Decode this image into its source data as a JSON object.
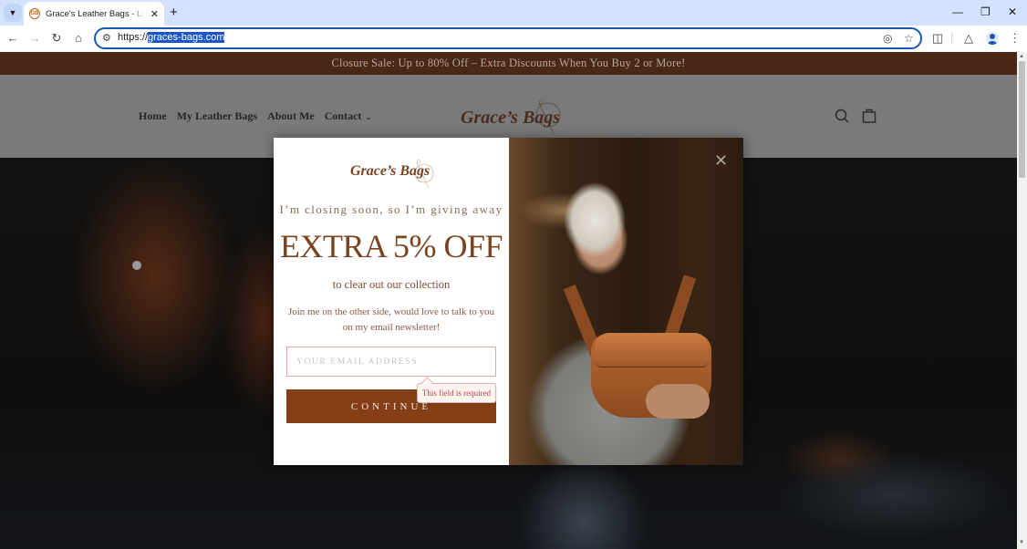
{
  "browser": {
    "tab": {
      "favicon_text": "GB",
      "title": "Grace's Leather Bags - Lovely n"
    },
    "url_prefix": "https://",
    "url_host": "graces-bags.com",
    "icons": {
      "tab_list": "chevron-down-icon",
      "new_tab": "plus-icon",
      "back": "arrow-left-icon",
      "forward": "arrow-right-icon",
      "reload": "reload-icon",
      "home": "home-icon",
      "site_info": "tune-icon",
      "eye_off": "eye-off-icon",
      "bookmark": "star-icon",
      "extensions": "puzzle-icon",
      "labs": "flask-icon",
      "profile": "avatar-icon",
      "menu": "kebab-icon"
    }
  },
  "site": {
    "announcement": "Closure Sale: Up to 80% Off – Extra Discounts When You Buy 2 or More!",
    "nav": [
      {
        "label": "Home"
      },
      {
        "label": "My Leather Bags"
      },
      {
        "label": "About Me"
      },
      {
        "label": "Contact",
        "has_dropdown": true
      }
    ],
    "logo_text": "Grace’s Bags"
  },
  "popup": {
    "logo_text": "Grace’s Bags",
    "subtitle": "I’m closing soon, so I’m giving away",
    "headline": "EXTRA 5% OFF",
    "subtitle2": "to clear out our collection",
    "body": "Join me on the other side, would love to talk to you on my email newsletter!",
    "email_placeholder": "YOUR EMAIL ADDRESS",
    "email_value": "",
    "button_label": "CONTINUE",
    "validation_message": "This field is required"
  },
  "colors": {
    "announcement_bg": "#4a2817",
    "brand_brown": "#7a4320",
    "button_bg": "#843f16",
    "error_text": "#b0474b",
    "url_highlight": "#1a56c9"
  }
}
